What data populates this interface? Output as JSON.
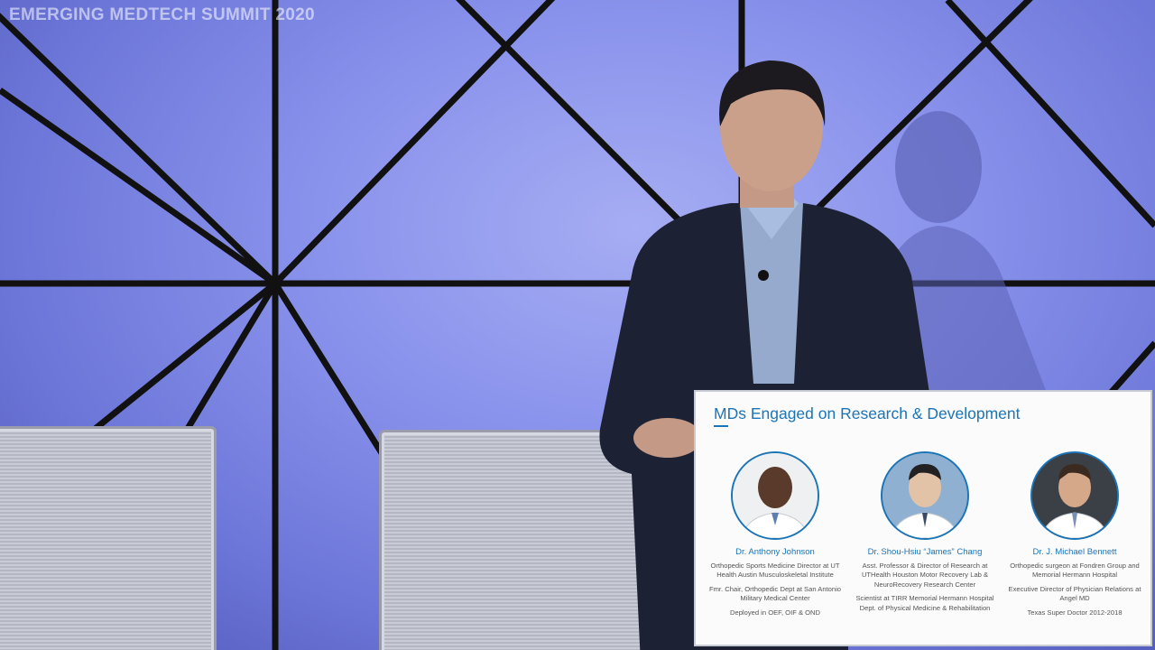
{
  "watermark": "EMERGING MEDTECH SUMMIT 2020",
  "slide": {
    "title": "MDs Engaged on Research & Development",
    "doctors": [
      {
        "name": "Dr. Anthony Johnson",
        "lines": [
          "Orthopedic Sports Medicine Director at UT Health Austin Musculoskeletal Institute",
          "Fmr. Chair, Orthopedic Dept at San Antonio Military Medical Center",
          "Deployed in OEF, OIF & OND"
        ]
      },
      {
        "name": "Dr. Shou-Hsiu “James” Chang",
        "lines": [
          "Asst. Professor & Director of Research at UTHealth Houston Motor Recovery Lab & NeuroRecovery Research Center",
          "Scientist at TIRR Memorial Hermann Hospital Dept. of Physical Medicine & Rehabilitation"
        ]
      },
      {
        "name": "Dr. J. Michael Bennett",
        "lines": [
          "Orthopedic surgeon at Fondren Group and Memorial Hermann Hospital",
          "Executive Director of Physician Relations at Angel MD",
          "Texas Super Doctor 2012-2018"
        ]
      }
    ]
  },
  "colors": {
    "accent": "#1b74b5",
    "stage_light": "#8a93ec"
  }
}
